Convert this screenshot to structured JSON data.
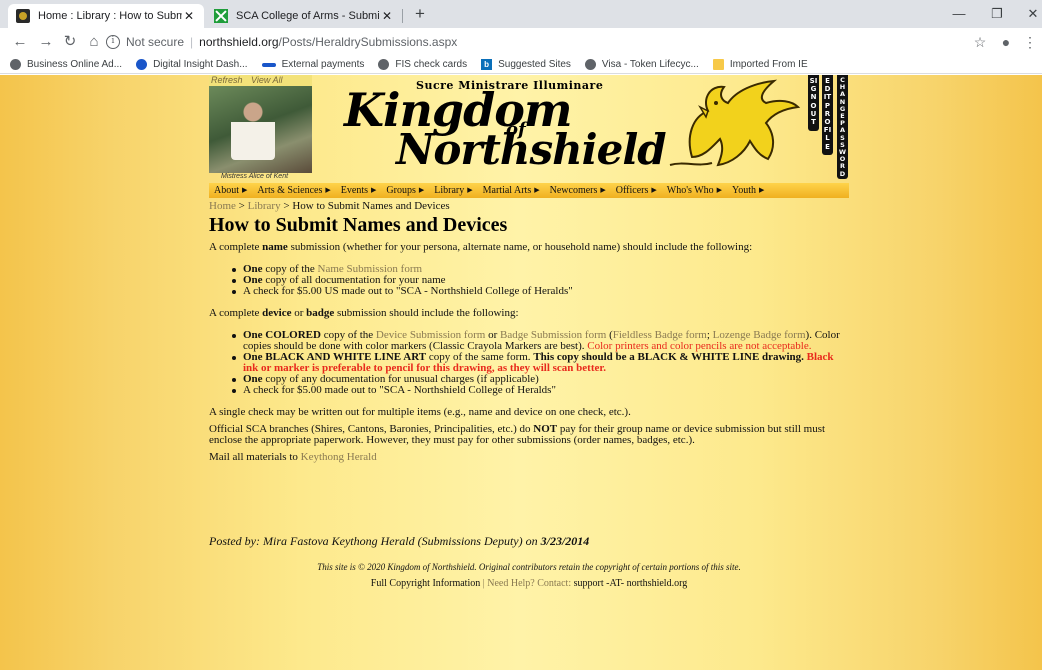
{
  "browser": {
    "tabs": [
      {
        "title": "Home : Library : How to Submit N",
        "close": "✕",
        "active": true
      },
      {
        "title": "SCA College of Arms - Submissio",
        "close": "✕",
        "active": false
      }
    ],
    "new_tab": "+",
    "window_controls": {
      "minimize": "—",
      "restore": "❐",
      "close": "✕"
    },
    "address": {
      "security": "Not secure",
      "host": "northshield.org",
      "path": "/Posts/HeraldrySubmissions.aspx"
    },
    "bookmarks": [
      {
        "label": "Business Online Ad...",
        "icon": "globe-icon"
      },
      {
        "label": "Digital Insight Dash...",
        "icon": "dot-icon"
      },
      {
        "label": "External payments",
        "icon": "bank-icon"
      },
      {
        "label": "FIS check cards",
        "icon": "globe-icon"
      },
      {
        "label": "Suggested Sites",
        "icon": "bing-icon"
      },
      {
        "label": "Visa - Token Lifecyc...",
        "icon": "globe-icon"
      },
      {
        "label": "Imported From IE",
        "icon": "folder-icon"
      }
    ]
  },
  "banner": {
    "photo_links": {
      "refresh": "Refresh",
      "view_all": "View All"
    },
    "photo_caption": "Mistress Alice of Kent",
    "motto": "Sucre Ministrare Illuminare",
    "title_1": "Kingdom",
    "title_of": "of",
    "title_2": "Northshield",
    "vertical_buttons": [
      "SIGN OUT",
      "EDIT PROFILE",
      "CHANGE PASSWORD"
    ]
  },
  "menu": [
    "About",
    "Arts & Sciences",
    "Events",
    "Groups",
    "Library",
    "Martial Arts",
    "Newcomers",
    "Officers",
    "Who's Who",
    "Youth"
  ],
  "breadcrumb": {
    "home": "Home",
    "sep": ">",
    "library": "Library",
    "current": "How to Submit Names and Devices"
  },
  "page_title": "How to Submit Names and Devices",
  "name_section": {
    "intro_a": "A complete ",
    "intro_b": "name",
    "intro_c": " submission (whether for your persona, alternate name, or household name) should include the following:",
    "items": [
      {
        "b": "One",
        "t": " copy of the ",
        "link": "Name Submission form"
      },
      {
        "b": "One",
        "t": " copy of all documentation for your name"
      },
      {
        "t": "A check for $5.00 US made out to \"SCA - Northshield College of Heralds\""
      }
    ]
  },
  "device_section": {
    "intro_a": "A complete ",
    "intro_b": "device",
    "intro_c": " or ",
    "intro_d": "badge",
    "intro_e": " submission should include the following:",
    "item1": {
      "b": "One COLORED",
      "t1": " copy of the ",
      "link1": "Device Submission form",
      "t2": " or ",
      "link2": "Badge Submission form",
      "t3": " (",
      "link3": "Fieldless Badge form",
      "t4": "; ",
      "link4": "Lozenge Badge form",
      "t5": "). Color copies should be done with color markers (Classic Crayola Markers are best). ",
      "red": "Color printers and color pencils are not acceptable."
    },
    "item2": {
      "b1": "One BLACK AND WHITE LINE ART",
      "t": " copy of the same form. ",
      "b2": "This copy should be a BLACK & WHITE LINE drawing. ",
      "red": "Black ink or marker is preferable to pencil for this drawing, as they will scan better."
    },
    "item3": {
      "b": "One",
      "t": " copy of any documentation for unusual charges (if applicable)"
    },
    "item4": {
      "t": "A check for $5.00 made out to \"SCA - Northshield College of Heralds\""
    }
  },
  "single_check": "A single check may be written out for multiple items (e.g., name and device on one check, etc.).",
  "official": {
    "a": "Official SCA branches (Shires, Cantons, Baronies, Principalities, etc.) do ",
    "b": "NOT",
    "c": " pay for their group name or device submission but still must enclose the appropriate paperwork. However, they must pay for other submissions (order names, badges, etc.)."
  },
  "mail": {
    "t": "Mail all materials to ",
    "link": "Keythong Herald"
  },
  "posted": {
    "prefix": "Posted by: Mira Fastova Keythong Herald (Submissions Deputy) on ",
    "date": "3/23/2014"
  },
  "footer": {
    "copyright": "This site is © 2020 Kingdom of Northshield. Original contributors retain the copyright of certain portions of this site.",
    "full": "Full Copyright Information",
    "sep": " | ",
    "help": "Need Help? Contact:",
    "email": " support -AT- northshield.org"
  },
  "colors": {
    "page_bg": "#fde98c",
    "link": "#8a7a52",
    "warning": "#e8291c",
    "menu_bg": "#f7c22e"
  }
}
